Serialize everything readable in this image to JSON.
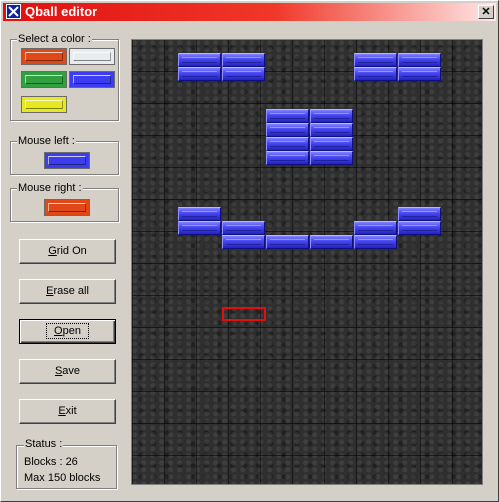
{
  "window": {
    "title": "Qball editor",
    "close_glyph": "✕",
    "icon": "qball-app-icon"
  },
  "palette": {
    "label": "Select a color :",
    "colors": [
      {
        "name": "red",
        "hex": "#e04818"
      },
      {
        "name": "white",
        "hex": "#e8ecee"
      },
      {
        "name": "green",
        "hex": "#30a040"
      },
      {
        "name": "blue",
        "hex": "#3c3cf0"
      },
      {
        "name": "yellow",
        "hex": "#e8e820"
      }
    ]
  },
  "mouse_left": {
    "label": "Mouse left :",
    "color": "#3c3cf0"
  },
  "mouse_right": {
    "label": "Mouse right :",
    "color": "#e04818"
  },
  "buttons": {
    "grid": {
      "accel": "G",
      "rest": "rid On"
    },
    "erase": {
      "accel": "E",
      "rest": "rase all"
    },
    "open": {
      "accel": "O",
      "rest": "pen"
    },
    "save": {
      "accel": "S",
      "rest": "ave"
    },
    "exit": {
      "accel": "E",
      "rest": "xit"
    }
  },
  "status": {
    "label": "Status :",
    "blocks": "Blocks : 26",
    "max": "Max 150 blocks"
  },
  "board": {
    "brick_color": "#4646f0",
    "cursor_color": "#e01010",
    "blocks": [
      {
        "col": 1,
        "row": 1
      },
      {
        "col": 2,
        "row": 1
      },
      {
        "col": 5,
        "row": 1
      },
      {
        "col": 6,
        "row": 1
      },
      {
        "col": 1,
        "row": 2
      },
      {
        "col": 2,
        "row": 2
      },
      {
        "col": 5,
        "row": 2
      },
      {
        "col": 6,
        "row": 2
      },
      {
        "col": 3,
        "row": 5
      },
      {
        "col": 4,
        "row": 5
      },
      {
        "col": 3,
        "row": 6
      },
      {
        "col": 4,
        "row": 6
      },
      {
        "col": 3,
        "row": 7
      },
      {
        "col": 4,
        "row": 7
      },
      {
        "col": 3,
        "row": 8
      },
      {
        "col": 4,
        "row": 8
      },
      {
        "col": 1,
        "row": 12
      },
      {
        "col": 6,
        "row": 12
      },
      {
        "col": 1,
        "row": 13
      },
      {
        "col": 2,
        "row": 13
      },
      {
        "col": 5,
        "row": 13
      },
      {
        "col": 6,
        "row": 13
      },
      {
        "col": 2,
        "row": 14
      },
      {
        "col": 3,
        "row": 14
      },
      {
        "col": 4,
        "row": 14
      },
      {
        "col": 5,
        "row": 14
      }
    ],
    "cursor": {
      "col": 2,
      "row": 19
    }
  }
}
